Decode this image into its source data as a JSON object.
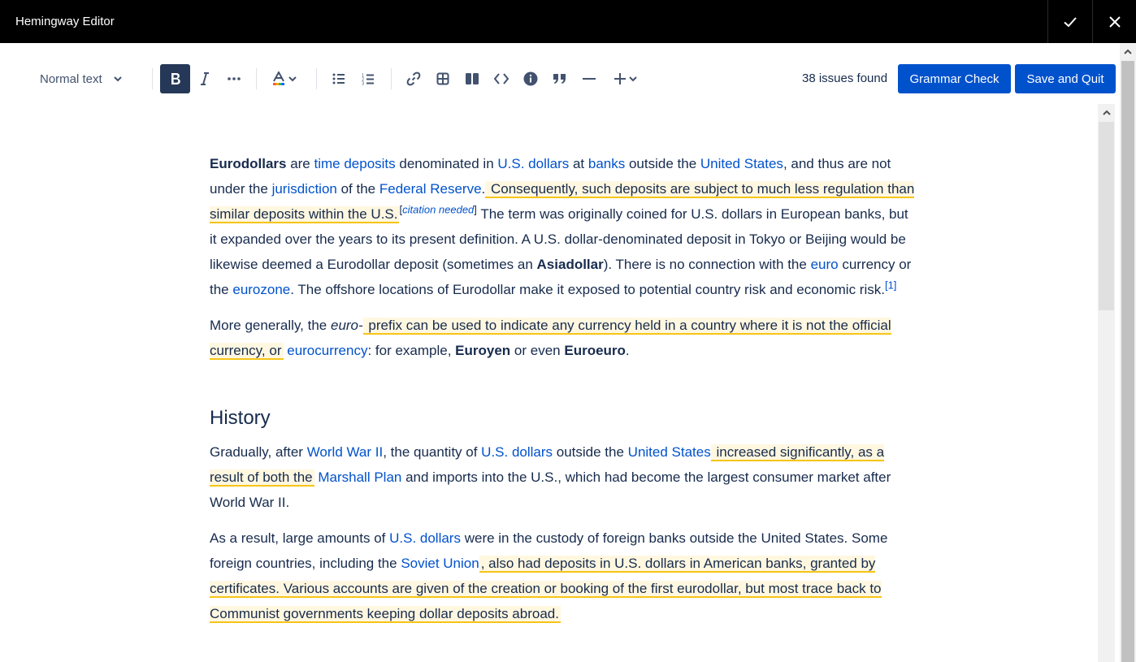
{
  "window": {
    "title": "Hemingway Editor"
  },
  "toolbar": {
    "text_style": "Normal text",
    "issues": "38 issues found",
    "grammar_check": "Grammar Check",
    "save_and_quit": "Save and Quit"
  },
  "content": {
    "p1": {
      "b1": "Eurodollars",
      "t1": " are ",
      "l1": "time deposits",
      "t2": " denominated in ",
      "l2": "U.S. dollars",
      "t3": " at ",
      "l3": "banks",
      "t4": " outside the ",
      "l4": "United States",
      "t5": ", and thus are not under the ",
      "l5": "jurisdiction",
      "t6": " of the ",
      "l6": "Federal Reserve",
      "t7": ".",
      "h1": " Consequently, such deposits are subject to much less regulation than similar deposits within the U.S.",
      "c1_open": "[",
      "c1": "citation needed",
      "c1_close": "]",
      "t8": " The term was originally coined for U.S. dollars in European banks, but it expanded over the years to its present definition. A U.S. dollar-denominated deposit in Tokyo or Beijing would be likewise deemed a Eurodollar deposit (sometimes an ",
      "b2": "Asiadollar",
      "t9": "). There is no connection with the ",
      "l7": "euro",
      "t10": " currency or the ",
      "l8": "eurozone",
      "t11": ". The offshore locations of Eurodollar make it exposed to potential country risk and economic risk.",
      "ref1": "[1]"
    },
    "p2": {
      "t1": "More generally, the ",
      "i1": "euro-",
      "h1": " prefix can be used to indicate any currency held in a country where it is not the official currency, or",
      "t2": " ",
      "l1": "eurocurrency",
      "t3": ": for example, ",
      "b1": "Euroyen",
      "t4": " or even ",
      "b2": "Euroeuro",
      "t5": "."
    },
    "heading": "History",
    "p3": {
      "t1": "Gradually, after ",
      "l1": "World War II",
      "t2": ", the quantity of ",
      "l2": "U.S. dollars",
      "t3": " outside the ",
      "l3": "United States",
      "h1": " increased significantly, as a result of both the",
      "t4": " ",
      "l4": "Marshall Plan",
      "t5": " and imports into the U.S., which had become the largest consumer market after World War II."
    },
    "p4": {
      "t1": "As a result, large amounts of ",
      "l1": "U.S. dollars",
      "t2": " were in the custody of foreign banks outside the United States. Some foreign countries, including the ",
      "l2": "Soviet Union",
      "h1": ", also had deposits in U.S. dollars in American banks, granted by certificates. Various accounts are given of the creation or booking of the first eurodollar, but most trace back to Communist governments keeping dollar deposits abroad."
    }
  }
}
